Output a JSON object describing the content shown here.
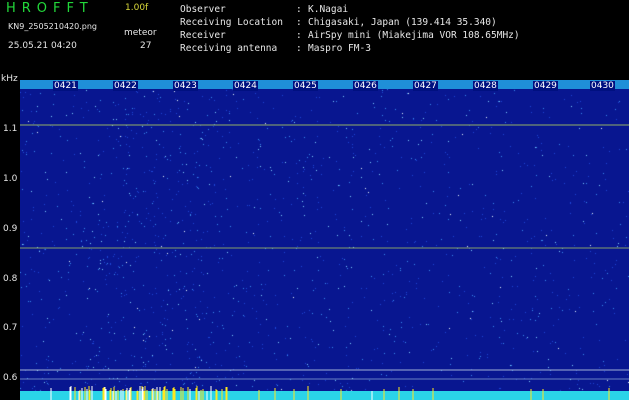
{
  "header": {
    "app_title": "HROFFT",
    "version": "1.00f",
    "file_name": "KN9_2505210420.png",
    "meteor_label": "meteor",
    "meteor_count": "27",
    "timestamp": "25.05.21 04:20"
  },
  "info": [
    {
      "key": "Observer",
      "sep": ":",
      "value": "K.Nagai"
    },
    {
      "key": "Receiving Location",
      "sep": ":",
      "value": "Chigasaki, Japan (139.414 35.340)"
    },
    {
      "key": "Receiver",
      "sep": ":",
      "value": "AirSpy mini (Miakejima VOR 108.65MHz)"
    },
    {
      "key": "Receiving antenna",
      "sep": ":",
      "value": "Maspro FM-3"
    }
  ],
  "y_axis": {
    "unit_label": "kHz",
    "ticks": [
      "1.1",
      "1.0",
      "0.9",
      "0.8",
      "0.7",
      "0.6"
    ]
  },
  "time_markers": [
    "0421",
    "0422",
    "0423",
    "0424",
    "0425",
    "0426",
    "0427",
    "0428",
    "0429",
    "0430"
  ],
  "colors": {
    "background": "#000000",
    "spectrogram_base": "#081690",
    "title_green": "#22d83a",
    "version_yellow": "#d8d83a",
    "text": "#e6e6e6",
    "baseline_cyan": "#2ad4e8",
    "meteor_yellow": "#ffe81e"
  }
}
